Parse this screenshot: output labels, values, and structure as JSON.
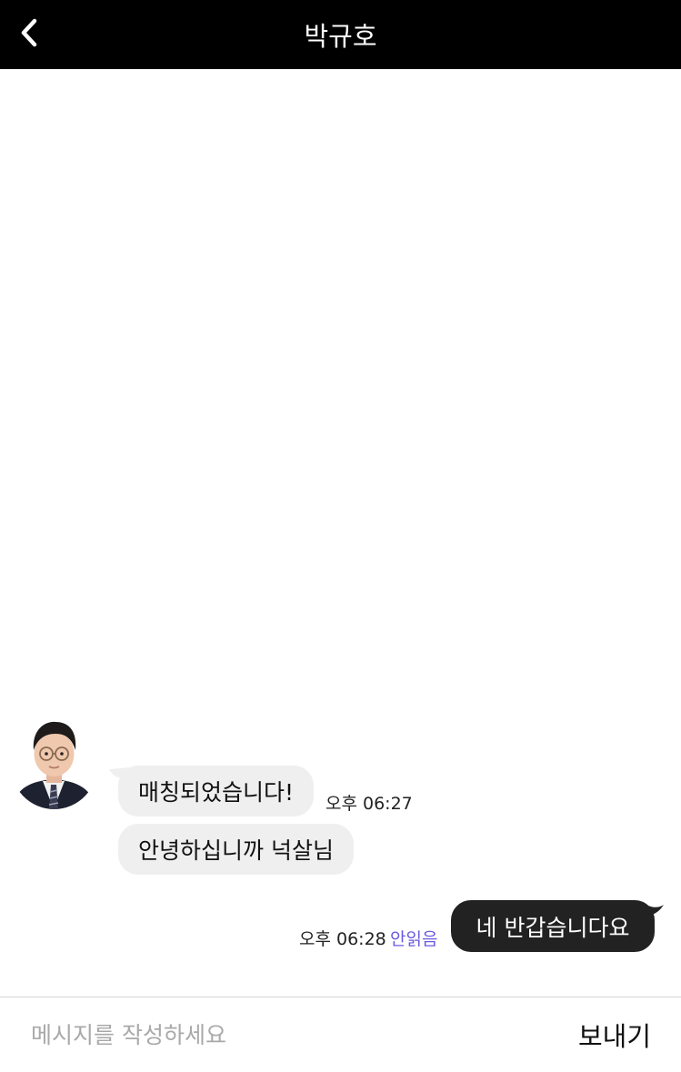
{
  "header": {
    "title": "박규호",
    "back_icon": "chevron-left-icon"
  },
  "messages": [
    {
      "direction": "received",
      "text": "매칭되었습니다!",
      "time": "오후 06:27"
    },
    {
      "direction": "received",
      "text": "안녕하십니까 넉살님"
    },
    {
      "direction": "sent",
      "text": "네 반갑습니다요",
      "time": "오후 06:28",
      "status": "안읽음"
    }
  ],
  "composer": {
    "placeholder": "메시지를 작성하세요",
    "value": "",
    "send_label": "보내기"
  },
  "colors": {
    "header_bg": "#000000",
    "received_bubble": "#efefef",
    "sent_bubble": "#222222",
    "unread_status": "#6a5ae0",
    "placeholder": "#a9a9a9"
  }
}
